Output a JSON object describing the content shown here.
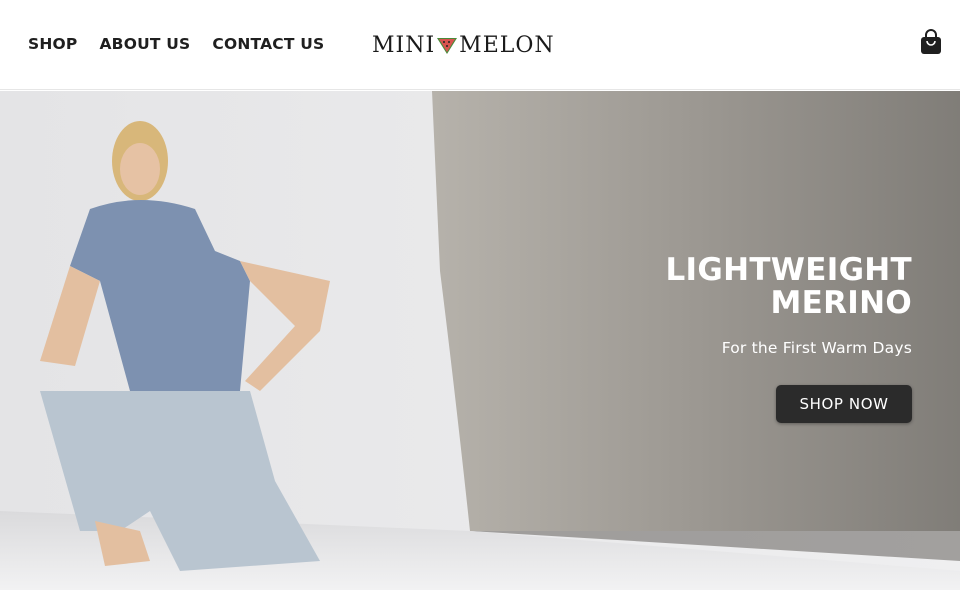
{
  "header": {
    "nav": [
      {
        "label": "SHOP"
      },
      {
        "label": "ABOUT US"
      },
      {
        "label": "CONTACT US"
      }
    ],
    "logo": {
      "left": "MINI",
      "right": "MELON"
    },
    "cart_icon": "shopping-bag-icon"
  },
  "hero": {
    "title": "LIGHTWEIGHT MERINO",
    "subtitle": "For the First Warm Days",
    "cta_label": "SHOP NOW"
  },
  "colors": {
    "text_dark": "#1f1f1f",
    "button_bg": "#2b2b2b",
    "logo_accent": "#d9534f"
  }
}
